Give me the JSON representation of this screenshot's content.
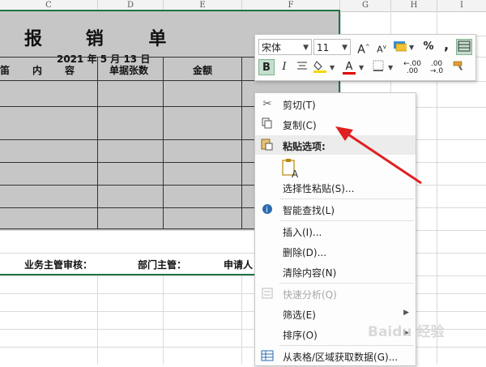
{
  "columns": [
    "C",
    "D",
    "E",
    "F",
    "G",
    "H",
    "I"
  ],
  "form": {
    "title": [
      "报",
      "销",
      "单"
    ],
    "date": "2021 年 5 月 13 日",
    "headers": [
      "笛",
      "内",
      "容",
      "单据张数",
      "金额"
    ],
    "footer": [
      "业务主管审核：",
      "部门主管：",
      "申请人"
    ]
  },
  "toolbar": {
    "font_name": "宋体",
    "font_size": "11",
    "bold": "B",
    "italic": "I",
    "grow_font": "A",
    "shrink_font": "A",
    "percent": "%",
    "comma": ",",
    "font_color_letter": "A",
    "inc_decimal": ".00",
    "dec_decimal": ".00",
    "fill_color": "#f5d800",
    "font_color": "#e00000",
    "accent": "#217346"
  },
  "menu": {
    "cut": "剪切(T)",
    "copy": "复制(C)",
    "paste_options": "粘贴选项:",
    "paste_special": "选择性粘贴(S)...",
    "smart_lookup": "智能查找(L)",
    "insert": "插入(I)...",
    "delete": "删除(D)...",
    "clear": "清除内容(N)",
    "quick_analysis": "快速分析(Q)",
    "filter": "筛选(E)",
    "sort": "排序(O)",
    "get_data": "从表格/区域获取数据(G)..."
  },
  "icons": {
    "cut": "scissors-icon",
    "copy": "copy-icon",
    "paste": "clipboard-icon",
    "smart_lookup": "info-search-icon",
    "quick_analysis": "quick-analysis-icon",
    "get_data": "table-icon",
    "format_painter": "paintbrush-icon",
    "borders": "borders-icon",
    "merge": "merge-cells-icon",
    "currency": "currency-format-icon"
  },
  "watermark": "Baidu 经验"
}
